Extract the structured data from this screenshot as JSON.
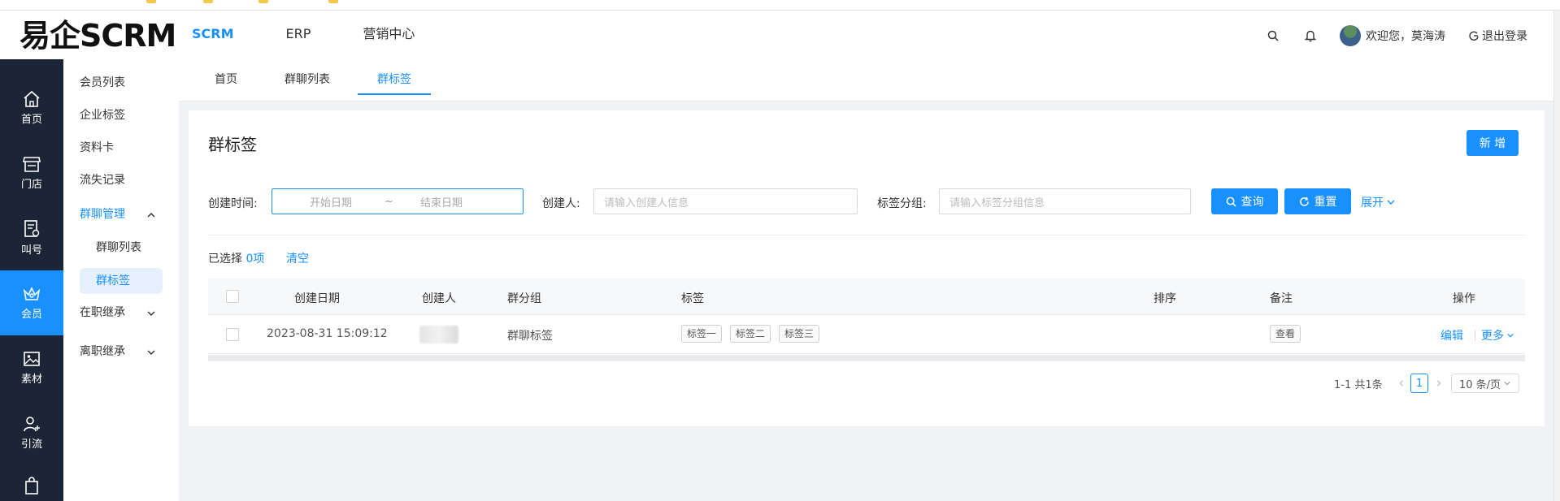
{
  "header": {
    "logo": "易企SCRM",
    "nav": [
      "SCRM",
      "ERP",
      "营销中心"
    ],
    "welcome": "欢迎您，莫海涛",
    "logout": "退出登录"
  },
  "sidebar_main": [
    {
      "label": "首页",
      "icon": "home-icon"
    },
    {
      "label": "门店",
      "icon": "store-icon"
    },
    {
      "label": "叫号",
      "icon": "queue-ticket-icon"
    },
    {
      "label": "会员",
      "icon": "crown-icon"
    },
    {
      "label": "素材",
      "icon": "image-icon"
    },
    {
      "label": "引流",
      "icon": "user-plus-icon"
    }
  ],
  "sidebar_sub": {
    "items": [
      "会员列表",
      "企业标签",
      "资料卡",
      "流失记录"
    ],
    "group_chat": "群聊管理",
    "group_children": [
      "群聊列表",
      "群标签"
    ],
    "on_job": "在职继承",
    "resigned": "离职继承"
  },
  "tabs": [
    "首页",
    "群聊列表",
    "群标签"
  ],
  "page": {
    "title": "群标签",
    "add_button": "新 增"
  },
  "filters": {
    "created_time_label": "创建时间:",
    "start_placeholder": "开始日期",
    "range_sep": "~",
    "end_placeholder": "结束日期",
    "creator_label": "创建人:",
    "creator_placeholder": "请输入创建人信息",
    "group_label": "标签分组:",
    "group_placeholder": "请输入标签分组信息",
    "query": "查询",
    "reset": "重置",
    "expand": "展开"
  },
  "selection": {
    "prefix": "已选择",
    "count": "0项",
    "clear": "清空"
  },
  "table": {
    "columns": [
      "创建日期",
      "创建人",
      "群分组",
      "标签",
      "排序",
      "备注",
      "操作"
    ],
    "rows": [
      {
        "created": "2023-08-31 15:09:12",
        "group": "群聊标签",
        "tags": [
          "标签一",
          "标签二",
          "标签三"
        ],
        "remark_btn": "查看",
        "edit": "编辑",
        "more": "更多"
      }
    ]
  },
  "pagination": {
    "summary": "1-1 共1条",
    "current": "1",
    "page_size": "10 条/页"
  }
}
